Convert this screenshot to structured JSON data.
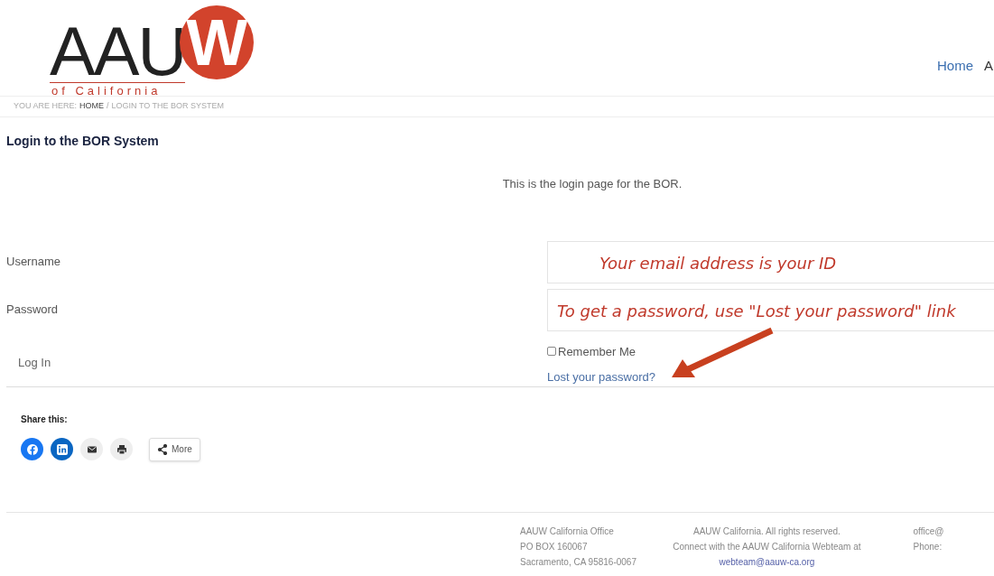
{
  "logo": {
    "letters": "AAU",
    "mark_letter": "W",
    "tagline": "of California"
  },
  "nav": [
    "Home",
    "A"
  ],
  "breadcrumb": {
    "prefix": "YOU ARE HERE:",
    "home": "HOME",
    "separator": "/",
    "current": "LOGIN TO THE BOR SYSTEM"
  },
  "title": "Login to the BOR System",
  "intro": "This is the login page for the BOR.",
  "form": {
    "fields": [
      {
        "label": "Username",
        "annotation": "Your email address is your ID"
      },
      {
        "label": "Password",
        "annotation": "To get a password, use \"Lost your password\" link"
      }
    ],
    "remember": {
      "label": "Remember Me",
      "checked": false
    },
    "lost_link": "Lost your password?",
    "submit": "Log In"
  },
  "share": {
    "title": "Share this:",
    "buttons": [
      {
        "kind": "facebook"
      },
      {
        "kind": "linkedin"
      },
      {
        "kind": "email"
      },
      {
        "kind": "print"
      },
      {
        "kind": "more",
        "label": "More"
      }
    ]
  },
  "footer": {
    "columns": [
      {
        "lines": [
          "AAUW California Office",
          "PO BOX 160067",
          "Sacramento, CA 95816-0067"
        ]
      },
      {
        "lines": [
          "AAUW California. All rights reserved.",
          "Connect with the AAUW California Webteam at"
        ],
        "link": "webteam@aauw-ca.org"
      },
      {
        "lines": [
          "office@",
          "Phone:"
        ]
      }
    ]
  }
}
